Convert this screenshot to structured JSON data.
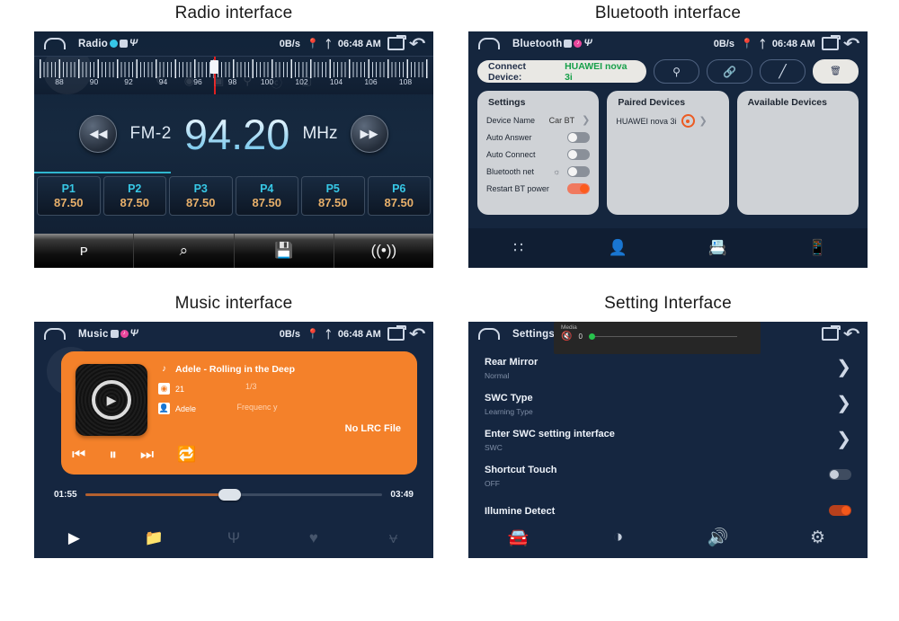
{
  "captions": {
    "radio": "Radio interface",
    "bluetooth": "Bluetooth interface",
    "music": "Music interface",
    "setting": "Setting Interface"
  },
  "statusbar": {
    "data_rate": "0B/s",
    "time": "06:48 AM",
    "titles": {
      "radio": "Radio",
      "bluetooth": "Bluetooth",
      "music": "Music",
      "setting": "Settings"
    },
    "icons": [
      "home-icon",
      "location-icon",
      "bluetooth-icon",
      "recent-apps-icon",
      "back-icon"
    ]
  },
  "radio": {
    "band_ticks": [
      "88",
      "90",
      "92",
      "94",
      "96",
      "98",
      "100",
      "102",
      "104",
      "106",
      "108"
    ],
    "band_label": "FM-2",
    "frequency": "94.20",
    "unit": "MHz",
    "prev_icon": "◀◀",
    "next_icon": "▶▶",
    "presets": [
      {
        "name": "P1",
        "freq": "87.50"
      },
      {
        "name": "P2",
        "freq": "87.50"
      },
      {
        "name": "P3",
        "freq": "87.50"
      },
      {
        "name": "P4",
        "freq": "87.50"
      },
      {
        "name": "P5",
        "freq": "87.50"
      },
      {
        "name": "P6",
        "freq": "87.50"
      }
    ],
    "toolbar": [
      {
        "name": "band-icon",
        "glyph": "ᴩ"
      },
      {
        "name": "search-icon",
        "glyph": "⌕"
      },
      {
        "name": "save-icon",
        "glyph": "💾"
      },
      {
        "name": "rds-icon",
        "glyph": "((•))"
      }
    ]
  },
  "bluetooth": {
    "connect_label": "Connect Device:",
    "connect_value": "HUAWEI nova 3i",
    "actions": [
      {
        "name": "search-device-button",
        "glyph": "⌕"
      },
      {
        "name": "link-button",
        "glyph": "🔗"
      },
      {
        "name": "unlink-button",
        "glyph": "╱"
      },
      {
        "name": "delete-button",
        "glyph": "🗑"
      }
    ],
    "settings": {
      "title": "Settings",
      "rows": [
        {
          "label": "Device Name",
          "value": "Car BT",
          "control": "chevron"
        },
        {
          "label": "Auto Answer",
          "value": "",
          "control": "toggle-off"
        },
        {
          "label": "Auto Connect",
          "value": "",
          "control": "toggle-off"
        },
        {
          "label": "Bluetooth net",
          "value": "",
          "control": "toggle-off"
        },
        {
          "label": "Restart BT power",
          "value": "",
          "control": "toggle-on"
        }
      ]
    },
    "paired": {
      "title": "Paired Devices",
      "devices": [
        "HUAWEI nova 3i"
      ]
    },
    "available": {
      "title": "Available Devices",
      "devices": []
    },
    "toolbar": [
      {
        "name": "dialpad-icon",
        "glyph": "∷"
      },
      {
        "name": "contacts-icon",
        "glyph": "👤"
      },
      {
        "name": "call-log-icon",
        "glyph": "📇"
      },
      {
        "name": "bluetooth-music-icon",
        "glyph": "📱"
      }
    ]
  },
  "music": {
    "track_title": "Adele - Rolling in the Deep",
    "album": "21",
    "artist": "Adele",
    "track_index": "1/3",
    "frequency_label": "Frequenc y",
    "lrc_status": "No LRC File",
    "time_current": "01:55",
    "time_total": "03:49",
    "controls": [
      {
        "name": "previous-track-button",
        "glyph": "⏮"
      },
      {
        "name": "pause-button",
        "glyph": "⏸"
      },
      {
        "name": "next-track-button",
        "glyph": "⏭"
      },
      {
        "name": "repeat-button",
        "glyph": "🔁"
      }
    ],
    "toolbar": [
      {
        "name": "play-icon",
        "glyph": "▶"
      },
      {
        "name": "folder-music-icon",
        "glyph": "📁"
      },
      {
        "name": "usb-icon",
        "glyph": "Ψ"
      },
      {
        "name": "favourite-icon",
        "glyph": "♥"
      },
      {
        "name": "equalizer-icon",
        "glyph": "⩝"
      }
    ]
  },
  "setting": {
    "volume_popup": {
      "label": "Media",
      "value": "0",
      "icon": "volume-mute-icon"
    },
    "rows": [
      {
        "title": "Rear Mirror",
        "sub": "Normal",
        "control": "chevron"
      },
      {
        "title": "SWC Type",
        "sub": "Learning Type",
        "control": "chevron"
      },
      {
        "title": "Enter SWC setting interface",
        "sub": "SWC",
        "control": "chevron"
      },
      {
        "title": "Shortcut Touch",
        "sub": "OFF",
        "control": "toggle-off"
      },
      {
        "title": "Illumine Detect",
        "sub": "",
        "control": "toggle-on"
      }
    ],
    "toolbar": [
      {
        "name": "car-icon",
        "glyph": "🚘"
      },
      {
        "name": "brightness-icon",
        "glyph": "◑"
      },
      {
        "name": "volume-icon",
        "glyph": "🔊"
      },
      {
        "name": "gear-icon",
        "glyph": "⚙"
      }
    ]
  },
  "colors": {
    "panel_bg": "#15263e",
    "accent_orange": "#f4812a",
    "accent_cyan": "#37c8e6",
    "preset_freq": "#e8b06a",
    "connected_green": "#17a04a"
  }
}
